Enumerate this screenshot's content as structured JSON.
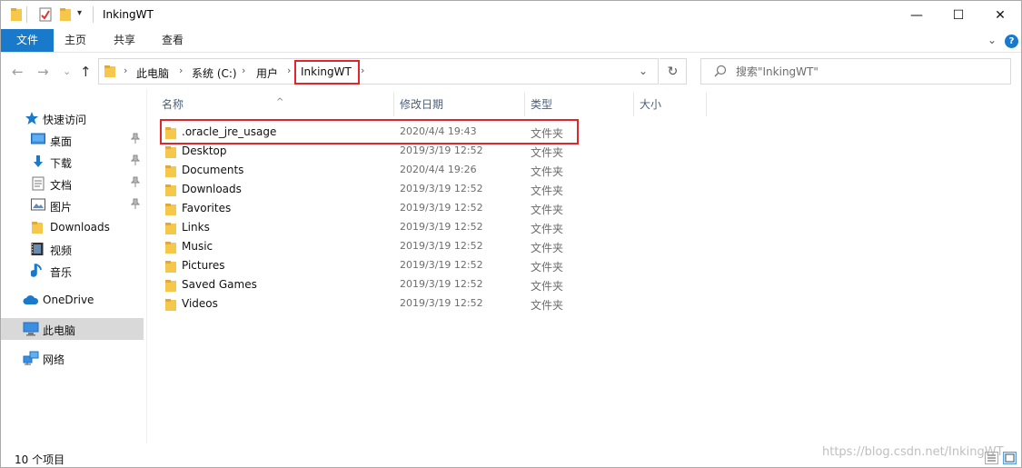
{
  "window": {
    "title": "InkingWT",
    "controls": {
      "minimize": "—",
      "maximize": "☐",
      "close": "✕"
    }
  },
  "ribbon": {
    "tabs": [
      "文件",
      "主页",
      "共享",
      "查看"
    ],
    "expand_glyph": "⌄",
    "help_glyph": "?"
  },
  "nav": {
    "back_glyph": "←",
    "forward_glyph": "→",
    "recent_glyph": "⌄",
    "up_glyph": "↑",
    "breadcrumb": [
      "此电脑",
      "系统 (C:)",
      "用户",
      "InkingWT"
    ],
    "sep_glyph": "›",
    "dropdown_glyph": "⌄",
    "refresh_glyph": "↻",
    "search_placeholder": "搜索\"InkingWT\""
  },
  "sidebar": {
    "quick_access": "快速访问",
    "items": [
      {
        "label": "桌面",
        "icon": "desktop-icon",
        "pinned": true
      },
      {
        "label": "下载",
        "icon": "download-icon",
        "pinned": true
      },
      {
        "label": "文档",
        "icon": "documents-icon",
        "pinned": true
      },
      {
        "label": "图片",
        "icon": "pictures-icon",
        "pinned": true
      },
      {
        "label": "Downloads",
        "icon": "folder-icon",
        "pinned": false
      },
      {
        "label": "视频",
        "icon": "videos-icon",
        "pinned": false
      },
      {
        "label": "音乐",
        "icon": "music-icon",
        "pinned": false
      }
    ],
    "onedrive": "OneDrive",
    "this_pc": "此电脑",
    "network": "网络",
    "pin_glyph": "📌"
  },
  "list": {
    "columns": [
      "名称",
      "修改日期",
      "类型",
      "大小"
    ],
    "sort_glyph": "^",
    "rows": [
      {
        "name": ".oracle_jre_usage",
        "date": "2020/4/4 19:43",
        "type": "文件夹"
      },
      {
        "name": "Desktop",
        "date": "2019/3/19 12:52",
        "type": "文件夹"
      },
      {
        "name": "Documents",
        "date": "2020/4/4 19:26",
        "type": "文件夹"
      },
      {
        "name": "Downloads",
        "date": "2019/3/19 12:52",
        "type": "文件夹"
      },
      {
        "name": "Favorites",
        "date": "2019/3/19 12:52",
        "type": "文件夹"
      },
      {
        "name": "Links",
        "date": "2019/3/19 12:52",
        "type": "文件夹"
      },
      {
        "name": "Music",
        "date": "2019/3/19 12:52",
        "type": "文件夹"
      },
      {
        "name": "Pictures",
        "date": "2019/3/19 12:52",
        "type": "文件夹"
      },
      {
        "name": "Saved Games",
        "date": "2019/3/19 12:52",
        "type": "文件夹"
      },
      {
        "name": "Videos",
        "date": "2019/3/19 12:52",
        "type": "文件夹"
      }
    ]
  },
  "status": {
    "item_count": "10 个项目"
  },
  "watermark": "https://blog.csdn.net/InkingWT",
  "colors": {
    "accent": "#1979ca",
    "folder": "#f5c84c",
    "highlight": "#e0262b",
    "selected": "#d9d9d9"
  }
}
